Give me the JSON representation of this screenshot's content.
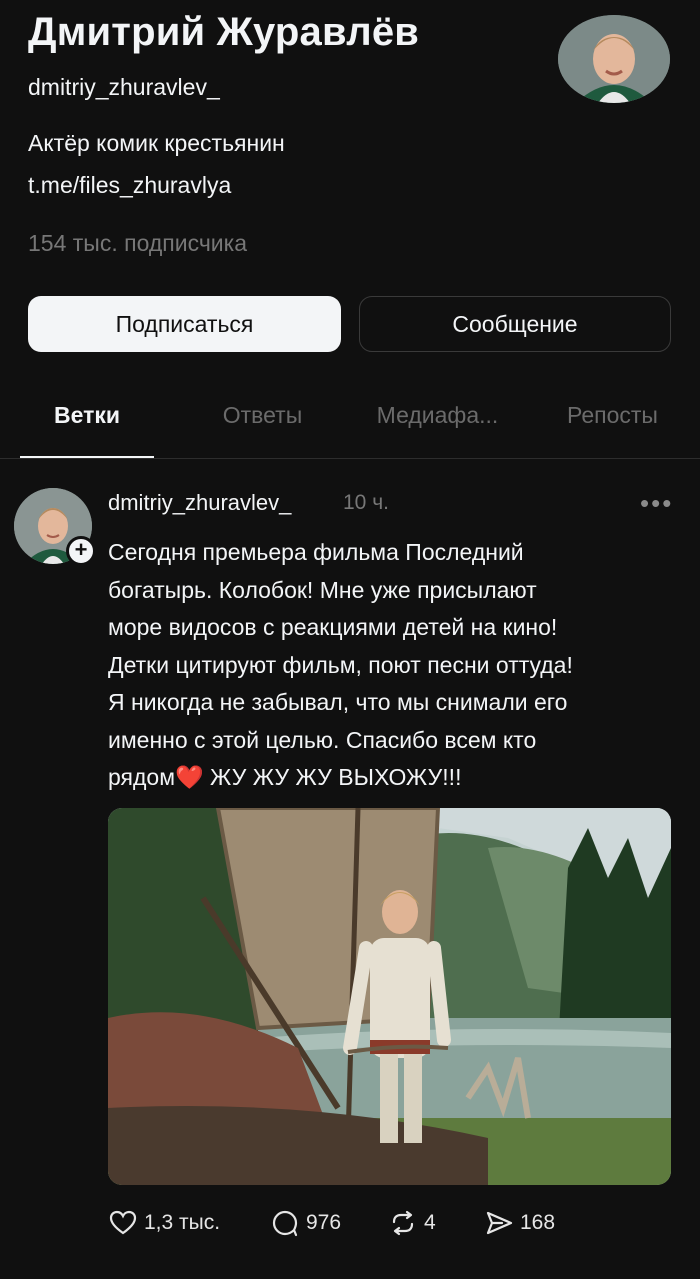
{
  "profile": {
    "name": "Дмитрий Журавлёв",
    "handle": "dmitriy_zhuravlev_",
    "bio_line1": "Актёр комик крестьянин",
    "bio_line2": "t.me/files_zhuravlya",
    "followers": "154 тыс. подписчика"
  },
  "buttons": {
    "subscribe": "Подписаться",
    "message": "Сообщение"
  },
  "tabs": [
    {
      "label": "Ветки",
      "active": true
    },
    {
      "label": "Ответы",
      "active": false
    },
    {
      "label": "Медиафа...",
      "active": false
    },
    {
      "label": "Репосты",
      "active": false
    }
  ],
  "post": {
    "username": "dmitriy_zhuravlev_",
    "time": "10 ч.",
    "more": "•••",
    "text": "Сегодня премьера фильма Последний\nбогатырь. Колобок! Мне уже присылают\nморе видосов с реакциями детей на кино!\nДетки цитируют фильм, поют песни оттуда!\nЯ никогда не забывал, что мы снимали его\nименно с этой целью. Спасибо всем кто\nрядом❤️ ЖУ ЖУ ЖУ ВЫХОЖУ!!!",
    "likes": "1,3 тыс.",
    "replies": "976",
    "reposts": "4",
    "shares": "168"
  },
  "colors": {
    "background": "#101010",
    "text": "#f3f5f7",
    "muted": "#777777",
    "heart": "#e0245e"
  }
}
